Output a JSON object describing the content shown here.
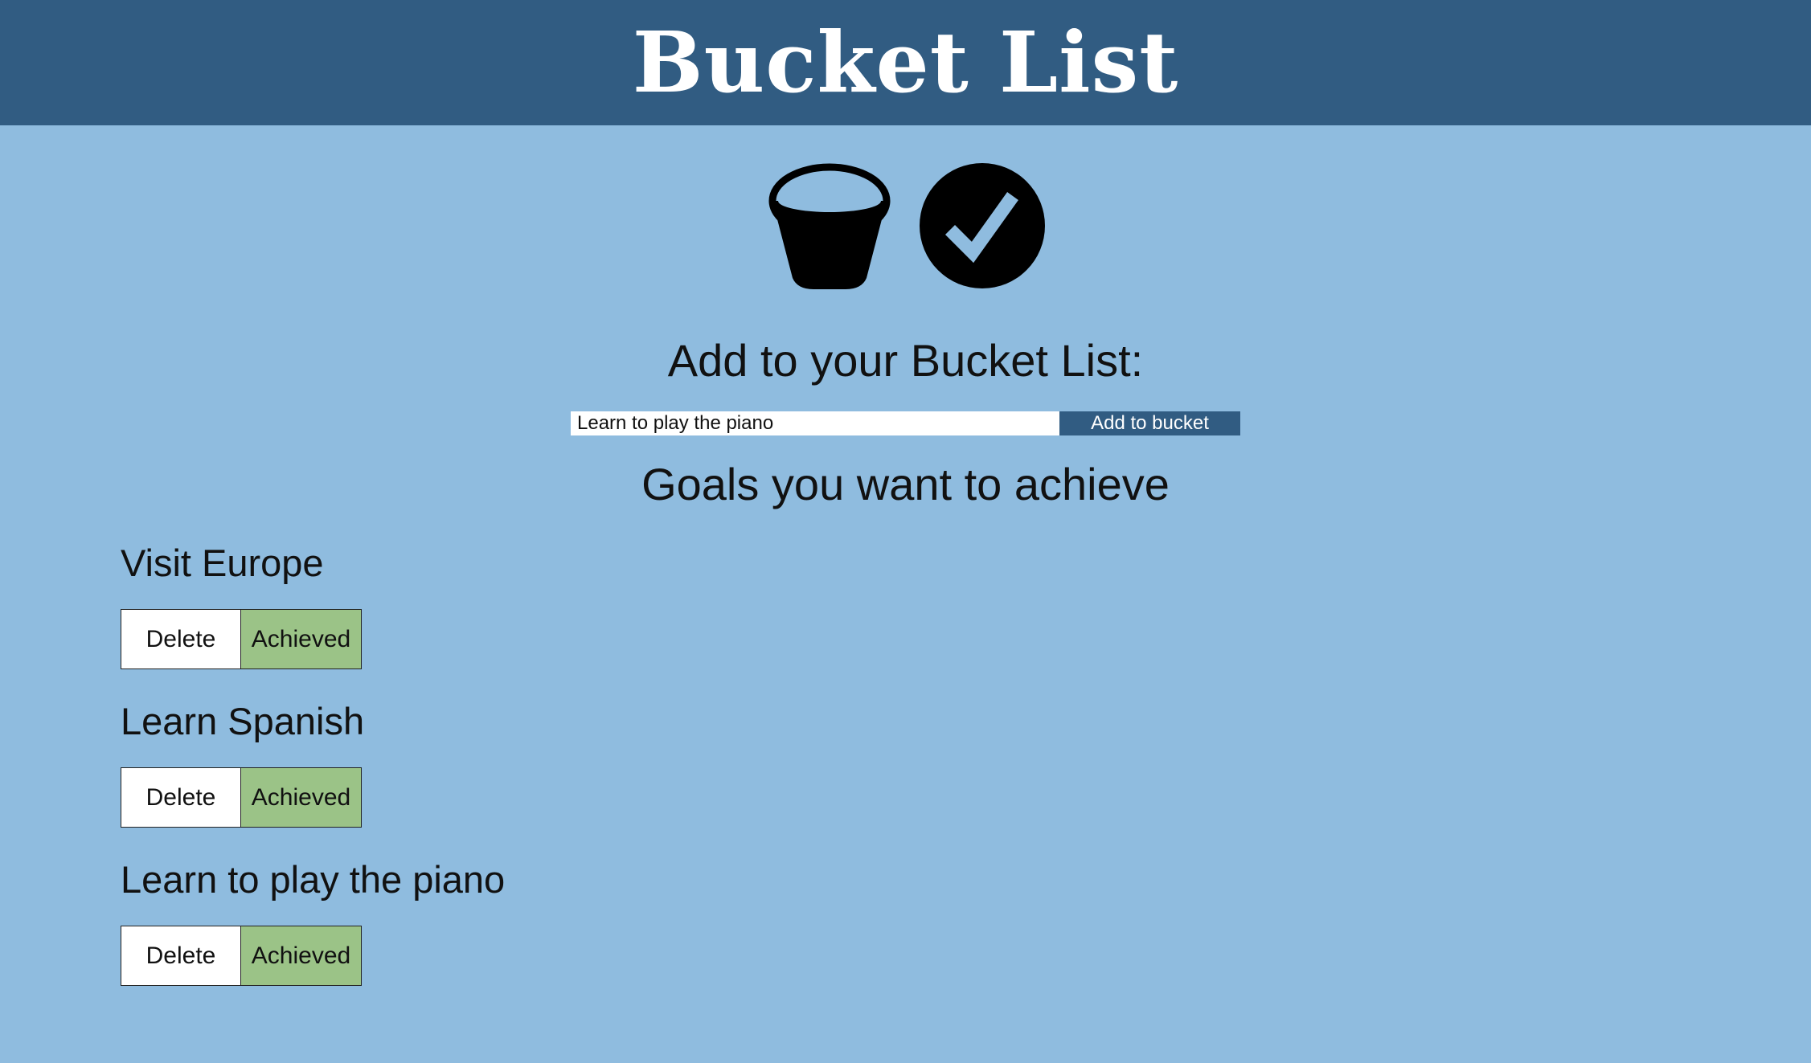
{
  "header": {
    "title": "Bucket List"
  },
  "icons": {
    "left": "bucket-icon",
    "right": "check-circle-icon"
  },
  "add_section": {
    "heading": "Add to your Bucket List:",
    "input_value": "Learn to play the piano",
    "button_label": "Add to bucket"
  },
  "goals_section": {
    "heading": "Goals you want to achieve",
    "items": [
      {
        "text": "Visit Europe",
        "delete_label": "Delete",
        "achieved_label": "Achieved"
      },
      {
        "text": "Learn Spanish",
        "delete_label": "Delete",
        "achieved_label": "Achieved"
      },
      {
        "text": "Learn to play the piano",
        "delete_label": "Delete",
        "achieved_label": "Achieved"
      }
    ]
  },
  "colors": {
    "header_background": "#315c82",
    "page_background": "#8fbcdf",
    "achieved_button": "#9bc387",
    "delete_button": "#ffffff",
    "add_button": "#315c82"
  }
}
